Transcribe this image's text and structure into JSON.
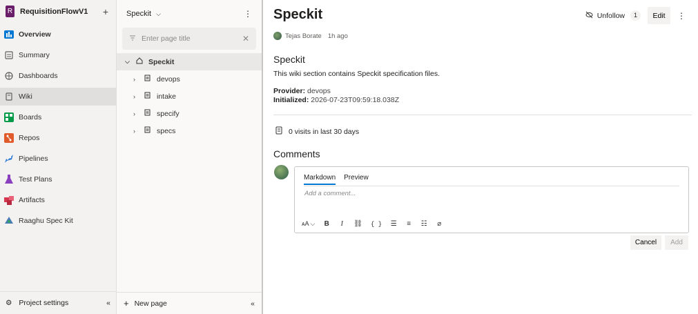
{
  "project": {
    "initial": "R",
    "name": "RequisitionFlowV1",
    "add_icon": "plus-icon"
  },
  "nav": {
    "items": [
      {
        "label": "Overview",
        "icon": "overview-icon",
        "color": "#0078d4"
      },
      {
        "label": "Summary",
        "icon": "summary-icon",
        "color": "#605e5c"
      },
      {
        "label": "Dashboards",
        "icon": "dashboards-icon",
        "color": "#605e5c"
      },
      {
        "label": "Wiki",
        "icon": "wiki-icon",
        "color": "#605e5c"
      },
      {
        "label": "Boards",
        "icon": "boards-icon",
        "color": "#009a49"
      },
      {
        "label": "Repos",
        "icon": "repos-icon",
        "color": "#e05a2b"
      },
      {
        "label": "Pipelines",
        "icon": "pipelines-icon",
        "color": "#2b7bd6"
      },
      {
        "label": "Test Plans",
        "icon": "testplans-icon",
        "color": "#8a3fbf"
      },
      {
        "label": "Artifacts",
        "icon": "artifacts-icon",
        "color": "#d6374f"
      },
      {
        "label": "Raaghu Spec Kit",
        "icon": "extension-icon",
        "color": "#4a7ab5"
      }
    ],
    "settings_label": "Project settings"
  },
  "tree": {
    "title": "Speckit",
    "search_placeholder": "Enter page title",
    "root": "Speckit",
    "children": [
      "devops",
      "intake",
      "specify",
      "specs"
    ],
    "new_page_label": "New page"
  },
  "page": {
    "title": "Speckit",
    "unfollow_label": "Unfollow",
    "follow_count": "1",
    "edit_label": "Edit",
    "author": "Tejas Borate",
    "time_ago": "1h ago",
    "heading": "Speckit",
    "description": "This wiki section contains Speckit specification files.",
    "provider_label": "Provider:",
    "provider_value": "devops",
    "initialized_label": "Initialized:",
    "initialized_value": "2026-07-23T09:59:18.038Z",
    "visits": "0 visits in last 30 days"
  },
  "comments": {
    "title": "Comments",
    "tab_markdown": "Markdown",
    "tab_preview": "Preview",
    "placeholder": "Add a comment...",
    "cancel_label": "Cancel",
    "add_label": "Add"
  }
}
